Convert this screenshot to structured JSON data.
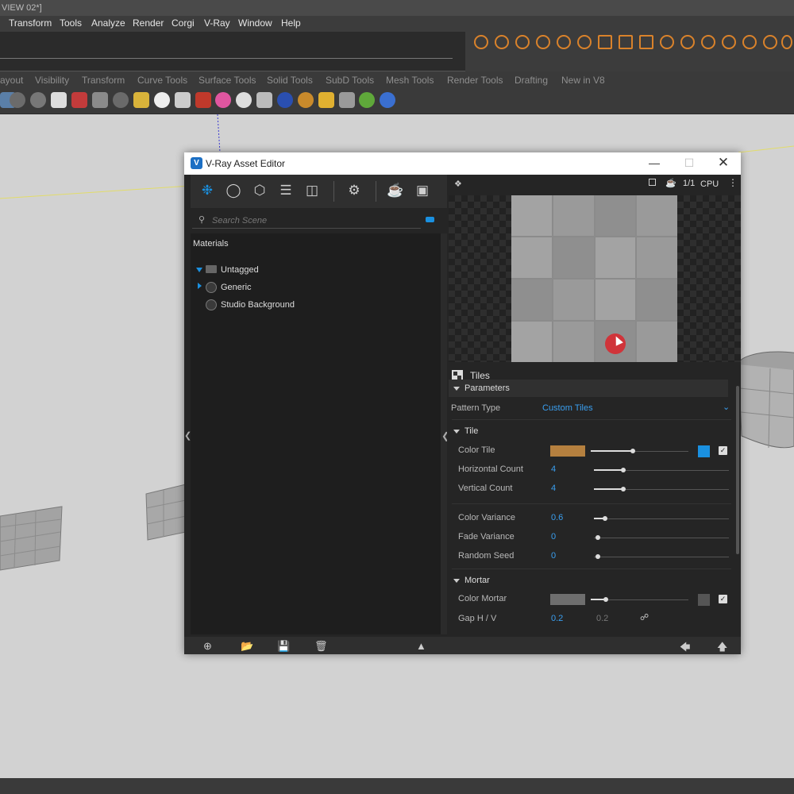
{
  "app": {
    "title_fragment": "VIEW 02*]",
    "menu": [
      "Transform",
      "Tools",
      "Analyze",
      "Render",
      "Corgi",
      "V-Ray",
      "Window",
      "Help"
    ],
    "tabs": [
      "ayout",
      "Visibility",
      "Transform",
      "Curve Tools",
      "Surface Tools",
      "Solid Tools",
      "SubD Tools",
      "Mesh Tools",
      "Render Tools",
      "Drafting",
      "New in V8"
    ]
  },
  "asset_editor": {
    "title": "V-Ray Asset Editor",
    "logo": "V",
    "search_placeholder": "Search Scene",
    "tree": {
      "header": "Materials",
      "items": [
        {
          "label": "Untagged",
          "expanded": true
        },
        {
          "label": "Generic",
          "expanded": false
        },
        {
          "label": "Studio Background"
        }
      ]
    },
    "preview": {
      "ratio": "1/1",
      "engine": "CPU"
    },
    "texture_name": "Tiles",
    "parameters_label": "Parameters",
    "pattern_type_label": "Pattern Type",
    "pattern_type_value": "Custom Tiles",
    "tile_section": "Tile",
    "rows": {
      "color_tile": {
        "label": "Color Tile",
        "color": "#b5803f"
      },
      "horizontal_count": {
        "label": "Horizontal Count",
        "value": "4"
      },
      "vertical_count": {
        "label": "Vertical Count",
        "value": "4"
      },
      "color_variance": {
        "label": "Color Variance",
        "value": "0.6"
      },
      "fade_variance": {
        "label": "Fade Variance",
        "value": "0"
      },
      "random_seed": {
        "label": "Random Seed",
        "value": "0"
      }
    },
    "mortar_section": "Mortar",
    "mortar": {
      "color_mortar": {
        "label": "Color Mortar",
        "color": "#6e6e6e"
      },
      "gap": {
        "label": "Gap H / V",
        "h": "0.2",
        "v": "0.2"
      }
    },
    "accent": "#1a90e0"
  }
}
